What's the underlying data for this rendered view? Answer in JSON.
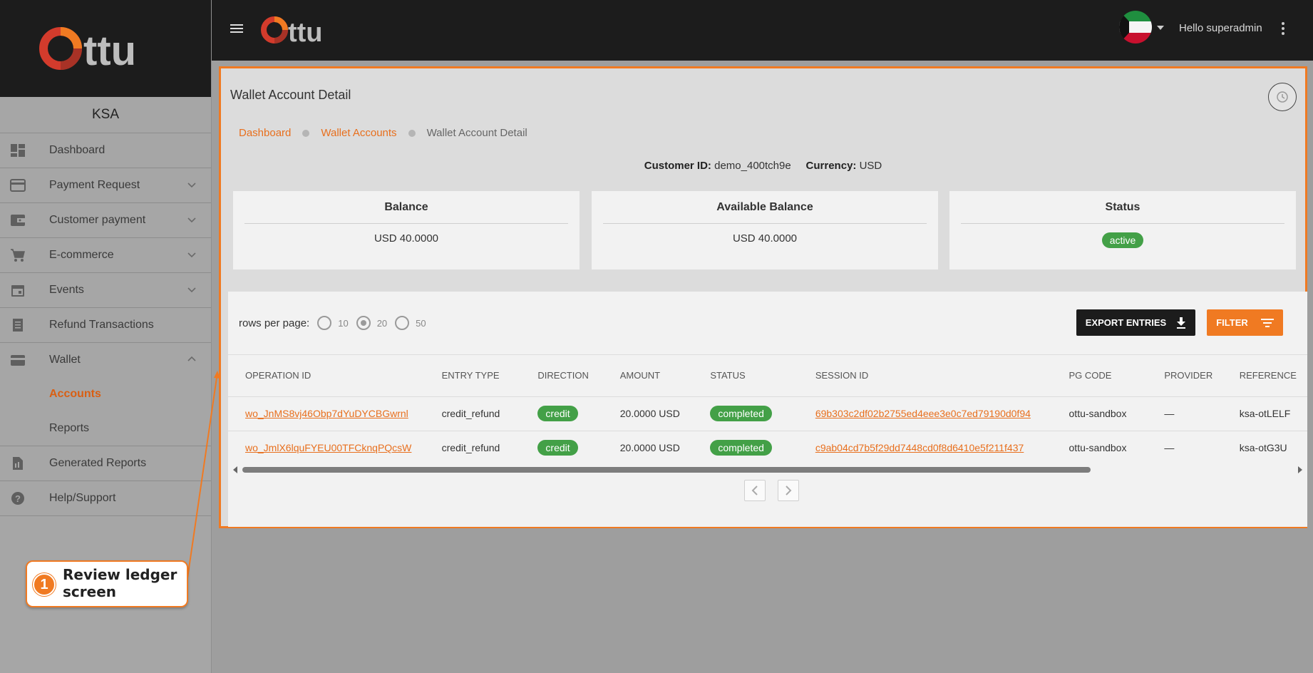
{
  "brand": {
    "name": "Ottu",
    "accent": "#f07a22",
    "logo_red": "#d33b2c"
  },
  "sidebar": {
    "region": "KSA",
    "items": [
      {
        "label": "Dashboard",
        "icon": "dashboard-icon",
        "expandable": false
      },
      {
        "label": "Payment Request",
        "icon": "credit-card-icon",
        "expandable": true
      },
      {
        "label": "Customer payment",
        "icon": "wallet-card-icon",
        "expandable": true
      },
      {
        "label": "E-commerce",
        "icon": "shopping-cart-icon",
        "expandable": true
      },
      {
        "label": "Events",
        "icon": "calendar-icon",
        "expandable": true
      },
      {
        "label": "Refund Transactions",
        "icon": "receipt-icon",
        "expandable": false
      },
      {
        "label": "Wallet",
        "icon": "wallet-icon",
        "expandable": true,
        "expanded": true
      }
    ],
    "wallet_sub": [
      {
        "label": "Accounts",
        "active": true
      },
      {
        "label": "Reports",
        "active": false
      }
    ],
    "bottom_items": [
      {
        "label": "Generated Reports",
        "icon": "report-file-icon"
      },
      {
        "label": "Help/Support",
        "icon": "help-icon"
      }
    ]
  },
  "topbar": {
    "greeting": "Hello superadmin",
    "flag": "kuwait-flag-icon"
  },
  "page": {
    "title": "Wallet Account Detail",
    "breadcrumb": [
      "Dashboard",
      "Wallet Accounts",
      "Wallet Account Detail"
    ],
    "customer_id_label": "Customer ID:",
    "customer_id": "demo_400tch9e",
    "currency_label": "Currency:",
    "currency": "USD"
  },
  "cards": {
    "balance": {
      "title": "Balance",
      "value": "USD 40.0000"
    },
    "available": {
      "title": "Available Balance",
      "value": "USD 40.0000"
    },
    "status": {
      "title": "Status",
      "value": "active",
      "color": "#43a047"
    }
  },
  "table_controls": {
    "rows_per_page_label": "rows per page:",
    "options": [
      "10",
      "20",
      "50"
    ],
    "selected": "20",
    "export_label": "EXPORT ENTRIES",
    "filter_label": "FILTER"
  },
  "table": {
    "columns": [
      "OPERATION ID",
      "ENTRY TYPE",
      "DIRECTION",
      "AMOUNT",
      "STATUS",
      "SESSION ID",
      "PG CODE",
      "PROVIDER",
      "REFERENCE"
    ],
    "rows": [
      {
        "operation_id": "wo_JnMS8vj46Obp7dYuDYCBGwrnl",
        "entry_type": "credit_refund",
        "direction": "credit",
        "amount": "20.0000 USD",
        "status": "completed",
        "session_id": "69b303c2df02b2755ed4eee3e0c7ed79190d0f94",
        "pg_code": "ottu-sandbox",
        "provider": "—",
        "reference": "ksa-otLELF"
      },
      {
        "operation_id": "wo_JmlX6lquFYEU00TFCknqPQcsW",
        "entry_type": "credit_refund",
        "direction": "credit",
        "amount": "20.0000 USD",
        "status": "completed",
        "session_id": "c9ab04cd7b5f29dd7448cd0f8d6410e5f211f437",
        "pg_code": "ottu-sandbox",
        "provider": "—",
        "reference": "ksa-otG3U"
      }
    ]
  },
  "callout": {
    "number": "1",
    "text": "Review ledger screen"
  }
}
